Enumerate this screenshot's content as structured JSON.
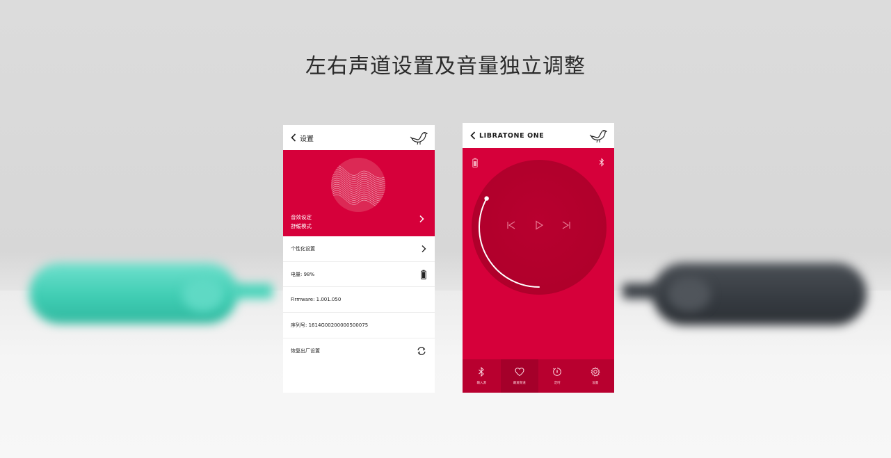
{
  "headline": "左右声道设置及音量独立调整",
  "settings_screen": {
    "title": "设置",
    "hero_label_line1": "音效设定",
    "hero_label_line2": "舒缓模式",
    "rows": [
      {
        "label": "个性化设置",
        "icon": "chevron-right-icon"
      },
      {
        "label": "电量: 98%",
        "icon": "battery-icon"
      },
      {
        "label": "Firmware: 1.001.050",
        "icon": ""
      },
      {
        "label": "序列号: 1614G00200000500075",
        "icon": ""
      },
      {
        "label": "恢复出厂设置",
        "icon": "refresh-icon"
      }
    ]
  },
  "player_screen": {
    "title": "LIBRATONE ONE",
    "volume_level": 0.33,
    "nav": [
      {
        "label": "输入源",
        "icon": "bluetooth-icon"
      },
      {
        "label": "最爱频道",
        "icon": "heart-icon"
      },
      {
        "label": "定时",
        "icon": "timer-icon"
      },
      {
        "label": "设置",
        "icon": "gear-icon"
      }
    ]
  },
  "colors": {
    "accent": "#d6003a",
    "disc": "#b0002b",
    "background": "#dcdcdc"
  }
}
